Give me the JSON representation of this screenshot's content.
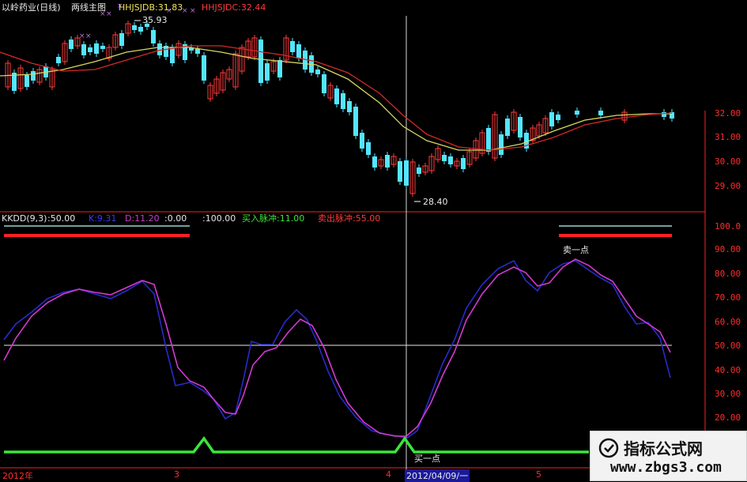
{
  "header": {
    "title": "以岭药业(日线)",
    "subtitle": "两线主图",
    "line1_label": "HHJSJDB:31.83",
    "line2_label": "HHJSJDC:32.44"
  },
  "annotations": {
    "high_marker": "35.93",
    "low_marker": "28.40",
    "sell_point": "卖一点",
    "buy_point": "买一点"
  },
  "indicator_header": {
    "name": "KKDD(9,3)",
    "value1": ":50.00",
    "k_label": "K:9.31",
    "d_label": "D:11.20",
    "value2": ":0.00",
    "value3": ":100.00",
    "buy_pulse": "买入脉冲:11.00",
    "sell_pulse": "卖出脉冲:55.00"
  },
  "x_axis": {
    "labels": [
      "2012年",
      "3",
      "4",
      "2012/04/09/一",
      "5"
    ]
  },
  "watermark": {
    "title": "指标公式网",
    "url": "www.zbgs3.com"
  },
  "colors": {
    "up": "#ff3a3a",
    "down": "#54e6ff",
    "ma_fast": "#d8d860",
    "ma_slow": "#d22a2a",
    "k_line": "#2a2acc",
    "d_line": "#d23ad2",
    "pulse": "#3ae63a",
    "axis": "#ff2020"
  },
  "chart_data": [
    {
      "type": "candlestick",
      "title": "以岭药业(日线)",
      "series": [
        {
          "name": "HHJSJDB",
          "last": 31.83
        },
        {
          "name": "HHJSJDC",
          "last": 32.44
        }
      ],
      "y_ticks": [
        29.0,
        30.0,
        31.0,
        32.0
      ],
      "ylim": [
        28.2,
        36.6
      ],
      "annotations": [
        {
          "label": "35.93"
        },
        {
          "label": "28.40"
        }
      ]
    },
    {
      "type": "line",
      "title": "KKDD(9,3)",
      "series": [
        {
          "name": "K"
        },
        {
          "name": "D"
        }
      ],
      "y_ticks": [
        20.0,
        30.0,
        40.0,
        50.0,
        60.0,
        70.0,
        80.0,
        90.0,
        100.0
      ],
      "ylim": [
        15,
        102
      ]
    }
  ]
}
